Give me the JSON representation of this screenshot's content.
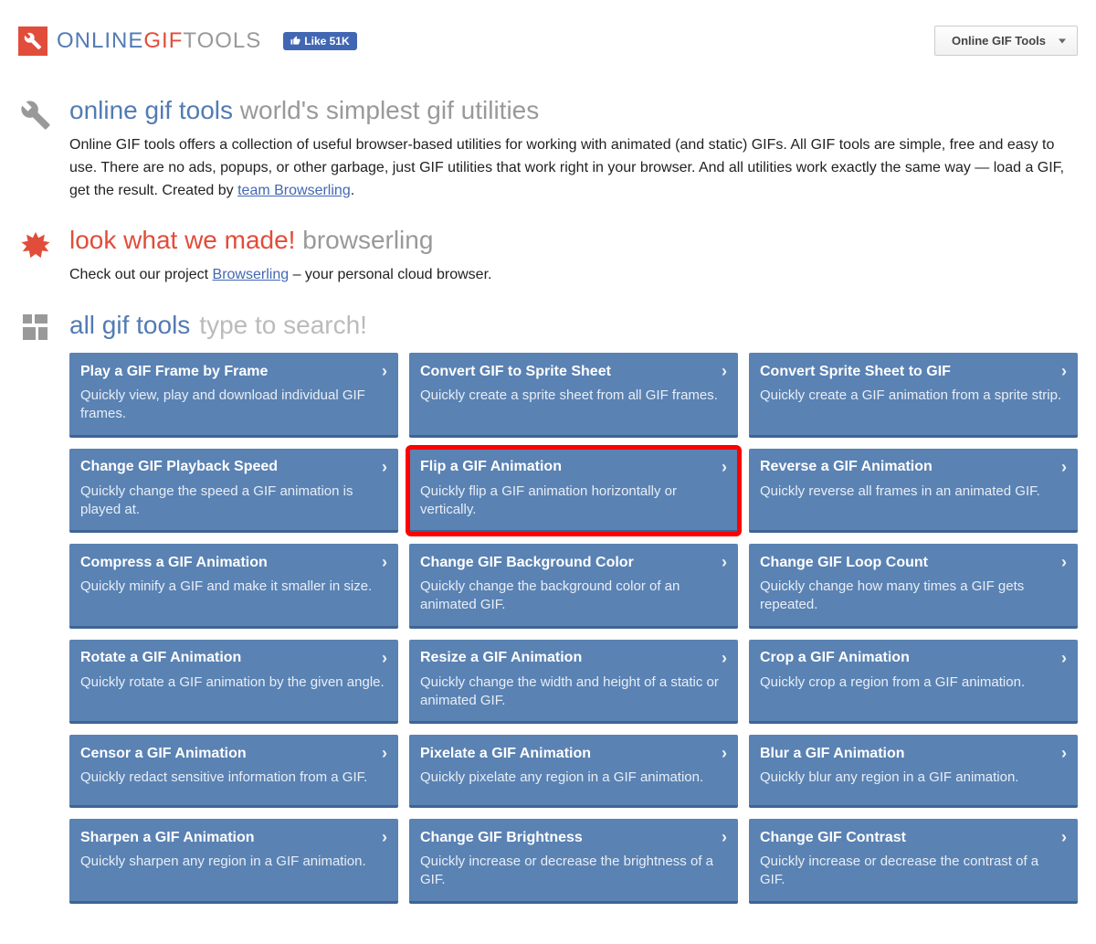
{
  "header": {
    "logo": {
      "part1": "ONLINE",
      "part2": "GIF",
      "part3": "TOOLS"
    },
    "fb_like_label": "Like 51K",
    "dropdown_label": "Online GIF Tools"
  },
  "intro": {
    "title_colored": "online gif tools",
    "title_gray": "world's simplest gif utilities",
    "description_pre": "Online GIF tools offers a collection of useful browser-based utilities for working with animated (and static) GIFs. All GIF tools are simple, free and easy to use. There are no ads, popups, or other garbage, just GIF utilities that work right in your browser. And all utilities work exactly the same way — load a GIF, get the result. Created by ",
    "link_text": "team Browserling",
    "description_post": "."
  },
  "promo": {
    "title_red": "look what we made!",
    "title_gray": "browserling",
    "desc_pre": "Check out our project ",
    "link_text": "Browserling",
    "desc_post": " – your personal cloud browser."
  },
  "tools_header": {
    "label": "all gif tools",
    "search_placeholder": "type to search!"
  },
  "tools": [
    {
      "title": "Play a GIF Frame by Frame",
      "desc": "Quickly view, play and download individual GIF frames.",
      "highlighted": false
    },
    {
      "title": "Convert GIF to Sprite Sheet",
      "desc": "Quickly create a sprite sheet from all GIF frames.",
      "highlighted": false
    },
    {
      "title": "Convert Sprite Sheet to GIF",
      "desc": "Quickly create a GIF animation from a sprite strip.",
      "highlighted": false
    },
    {
      "title": "Change GIF Playback Speed",
      "desc": "Quickly change the speed a GIF animation is played at.",
      "highlighted": false
    },
    {
      "title": "Flip a GIF Animation",
      "desc": "Quickly flip a GIF animation horizontally or vertically.",
      "highlighted": true
    },
    {
      "title": "Reverse a GIF Animation",
      "desc": "Quickly reverse all frames in an animated GIF.",
      "highlighted": false
    },
    {
      "title": "Compress a GIF Animation",
      "desc": "Quickly minify a GIF and make it smaller in size.",
      "highlighted": false
    },
    {
      "title": "Change GIF Background Color",
      "desc": "Quickly change the background color of an animated GIF.",
      "highlighted": false
    },
    {
      "title": "Change GIF Loop Count",
      "desc": "Quickly change how many times a GIF gets repeated.",
      "highlighted": false
    },
    {
      "title": "Rotate a GIF Animation",
      "desc": "Quickly rotate a GIF animation by the given angle.",
      "highlighted": false
    },
    {
      "title": "Resize a GIF Animation",
      "desc": "Quickly change the width and height of a static or animated GIF.",
      "highlighted": false
    },
    {
      "title": "Crop a GIF Animation",
      "desc": "Quickly crop a region from a GIF animation.",
      "highlighted": false
    },
    {
      "title": "Censor a GIF Animation",
      "desc": "Quickly redact sensitive information from a GIF.",
      "highlighted": false
    },
    {
      "title": "Pixelate a GIF Animation",
      "desc": "Quickly pixelate any region in a GIF animation.",
      "highlighted": false
    },
    {
      "title": "Blur a GIF Animation",
      "desc": "Quickly blur any region in a GIF animation.",
      "highlighted": false
    },
    {
      "title": "Sharpen a GIF Animation",
      "desc": "Quickly sharpen any region in a GIF animation.",
      "highlighted": false
    },
    {
      "title": "Change GIF Brightness",
      "desc": "Quickly increase or decrease the brightness of a GIF.",
      "highlighted": false
    },
    {
      "title": "Change GIF Contrast",
      "desc": "Quickly increase or decrease the contrast of a GIF.",
      "highlighted": false
    }
  ]
}
